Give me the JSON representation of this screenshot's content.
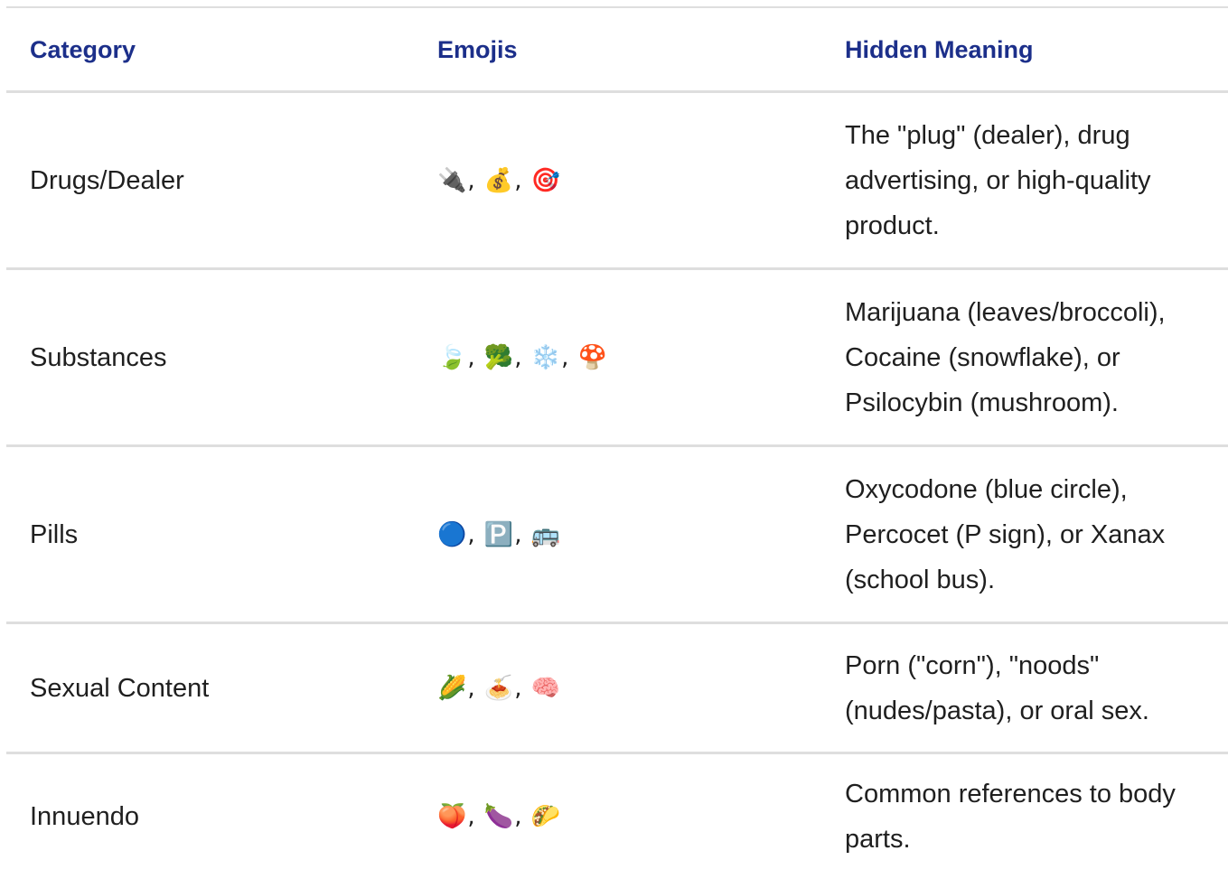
{
  "table": {
    "headers": {
      "category": "Category",
      "emojis": "Emojis",
      "meaning": "Hidden Meaning"
    },
    "rows": [
      {
        "category": "Drugs/Dealer",
        "emojis": "🔌, 💰, 🎯",
        "meaning": "The \"plug\" (dealer), drug advertising, or high-quality product."
      },
      {
        "category": "Substances",
        "emojis": "🍃, 🥦, ❄️, 🍄",
        "meaning": "Marijuana (leaves/broccoli), Cocaine (snowflake), or Psilocybin (mushroom)."
      },
      {
        "category": "Pills",
        "emojis": "🔵, 🅿️, 🚌",
        "meaning": "Oxycodone (blue circle), Percocet (P sign), or Xanax (school bus)."
      },
      {
        "category": "Sexual Content",
        "emojis": "🌽, 🍝, 🧠",
        "meaning": "Porn (\"corn\"), \"noods\" (nudes/pasta), or oral sex."
      },
      {
        "category": "Innuendo",
        "emojis": "🍑, 🍆, 🌮",
        "meaning": "Common references to body parts."
      }
    ]
  },
  "colors": {
    "header_text": "#1c2f8a",
    "body_text": "#1f1f1f",
    "divider": "#dedede"
  }
}
